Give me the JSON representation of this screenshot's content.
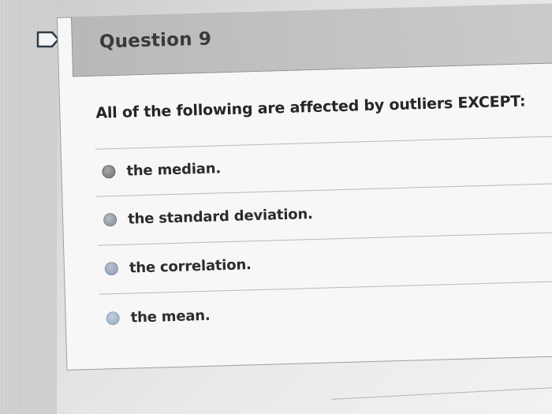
{
  "question": {
    "number_label": "Question 9",
    "prompt": "All of the following are affected by outliers EXCEPT:",
    "options": [
      {
        "label": "the median."
      },
      {
        "label": "the standard deviation."
      },
      {
        "label": "the correlation."
      },
      {
        "label": "the mean."
      }
    ]
  },
  "icons": {
    "flag": "flag-icon",
    "radio": "radio-button-icon"
  }
}
